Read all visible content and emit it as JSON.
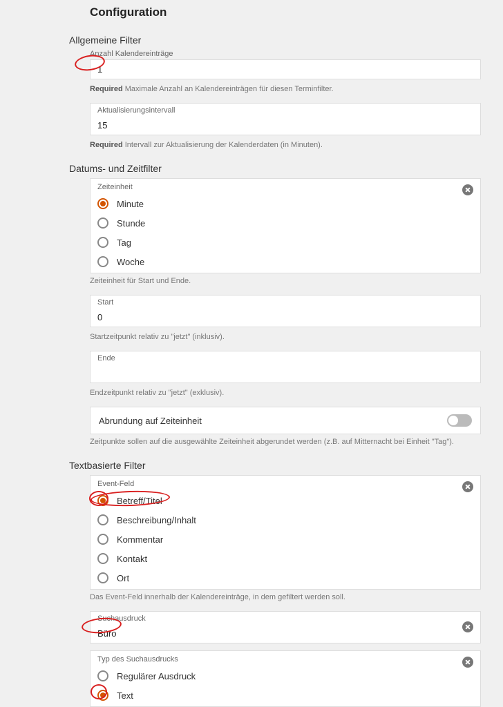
{
  "title": "Configuration",
  "sections": {
    "general": {
      "title": "Allgemeine Filter",
      "count": {
        "label": "Anzahl Kalendereinträge",
        "value": "1",
        "req": "Required",
        "helper": " Maximale Anzahl an Kalendereinträgen für diesen Terminfilter."
      },
      "interval": {
        "label": "Aktualisierungsintervall",
        "value": "15",
        "req": "Required",
        "helper": " Intervall zur Aktualisierung der Kalenderdaten (in Minuten)."
      }
    },
    "datetime": {
      "title": "Datums- und Zeitfilter",
      "unit": {
        "label": "Zeiteinheit",
        "options": [
          "Minute",
          "Stunde",
          "Tag",
          "Woche"
        ],
        "selected": "Minute",
        "helper": "Zeiteinheit für Start und Ende."
      },
      "start": {
        "label": "Start",
        "value": "0",
        "helper": "Startzeitpunkt relativ zu \"jetzt\" (inklusiv)."
      },
      "end": {
        "label": "Ende",
        "value": "",
        "helper": "Endzeitpunkt relativ zu \"jetzt\" (exklusiv)."
      },
      "round": {
        "label": "Abrundung auf Zeiteinheit",
        "on": false,
        "helper": "Zeitpunkte sollen auf die ausgewählte Zeiteinheit abgerundet werden (z.B. auf Mitternacht bei Einheit \"Tag\")."
      }
    },
    "textfilter": {
      "title": "Textbasierte Filter",
      "field": {
        "label": "Event-Feld",
        "options": [
          "Betreff/Titel",
          "Beschreibung/Inhalt",
          "Kommentar",
          "Kontakt",
          "Ort"
        ],
        "selected": "Betreff/Titel",
        "helper": "Das Event-Feld innerhalb der Kalendereinträge, in dem gefiltert werden soll."
      },
      "expr": {
        "label": "Suchausdruck",
        "value": "Büro"
      },
      "type": {
        "label": "Typ des Suchausdrucks",
        "options": [
          "Regulärer Ausdruck",
          "Text"
        ],
        "selected": "Text"
      }
    }
  }
}
